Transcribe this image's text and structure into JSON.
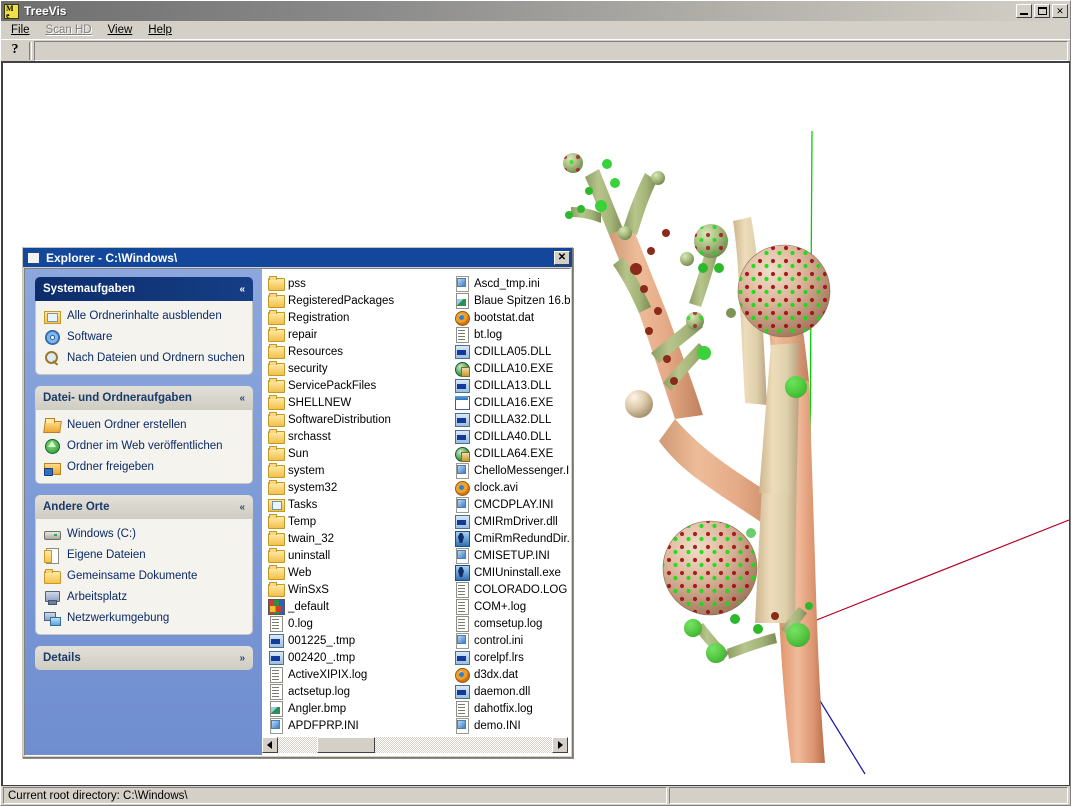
{
  "app": {
    "title": "TreeVis",
    "icon": "treevis-app-icon",
    "icon_glyph_top": "M",
    "icon_glyph_bottom": "e",
    "window_buttons": [
      {
        "name": "minimize-button",
        "label": "_"
      },
      {
        "name": "maximize-button",
        "label": "□"
      },
      {
        "name": "close-button",
        "label": "✕"
      }
    ],
    "menu": [
      {
        "label": "File",
        "enabled": true
      },
      {
        "label": "Scan HD",
        "enabled": false
      },
      {
        "label": "View",
        "enabled": true
      },
      {
        "label": "Help",
        "enabled": true
      }
    ],
    "toolbar": {
      "help_button_label": "?"
    },
    "statusbar": {
      "main": "Current root directory: C:\\Windows\\",
      "secondary": ""
    }
  },
  "explorer": {
    "title": "Explorer - C:\\Windows\\",
    "close_label": "✕",
    "panels": [
      {
        "name": "systemaufgaben",
        "title": "Systemaufgaben",
        "style": "blue",
        "chevron": "«",
        "collapsed": false,
        "items": [
          {
            "label": "Alle Ordnerinhalte ausblenden",
            "icon": "folder-window-icon"
          },
          {
            "label": "Software",
            "icon": "cd-software-icon"
          },
          {
            "label": "Nach Dateien und Ordnern suchen",
            "icon": "search-icon"
          }
        ]
      },
      {
        "name": "datei-und-ordneraufgaben",
        "title": "Datei- und Ordneraufgaben",
        "style": "gray",
        "chevron": "«",
        "collapsed": false,
        "items": [
          {
            "label": "Neuen Ordner erstellen",
            "icon": "new-folder-icon"
          },
          {
            "label": "Ordner im Web veröffentlichen",
            "icon": "web-publish-icon"
          },
          {
            "label": "Ordner freigeben",
            "icon": "share-folder-icon"
          }
        ]
      },
      {
        "name": "andere-orte",
        "title": "Andere Orte",
        "style": "gray",
        "chevron": "«",
        "collapsed": false,
        "items": [
          {
            "label": "Windows (C:)",
            "icon": "hard-drive-icon"
          },
          {
            "label": "Eigene Dateien",
            "icon": "my-documents-icon"
          },
          {
            "label": "Gemeinsame Dokumente",
            "icon": "shared-documents-icon"
          },
          {
            "label": "Arbeitsplatz",
            "icon": "my-computer-icon"
          },
          {
            "label": "Netzwerkumgebung",
            "icon": "network-icon"
          }
        ]
      },
      {
        "name": "details",
        "title": "Details",
        "style": "gray",
        "chevron": "»",
        "collapsed": true,
        "items": []
      }
    ],
    "file_columns": [
      {
        "name": "file-column-1",
        "items": [
          {
            "label": "pss",
            "icon": "folder-icon"
          },
          {
            "label": "RegisteredPackages",
            "icon": "folder-icon"
          },
          {
            "label": "Registration",
            "icon": "folder-icon"
          },
          {
            "label": "repair",
            "icon": "folder-icon"
          },
          {
            "label": "Resources",
            "icon": "folder-icon"
          },
          {
            "label": "security",
            "icon": "folder-icon"
          },
          {
            "label": "ServicePackFiles",
            "icon": "folder-icon"
          },
          {
            "label": "SHELLNEW",
            "icon": "folder-icon"
          },
          {
            "label": "SoftwareDistribution",
            "icon": "folder-icon"
          },
          {
            "label": "srchasst",
            "icon": "folder-icon"
          },
          {
            "label": "Sun",
            "icon": "folder-icon"
          },
          {
            "label": "system",
            "icon": "folder-icon"
          },
          {
            "label": "system32",
            "icon": "folder-icon"
          },
          {
            "label": "Tasks",
            "icon": "folder-task-icon"
          },
          {
            "label": "Temp",
            "icon": "folder-icon"
          },
          {
            "label": "twain_32",
            "icon": "folder-icon"
          },
          {
            "label": "uninstall",
            "icon": "folder-icon"
          },
          {
            "label": "Web",
            "icon": "folder-icon"
          },
          {
            "label": "WinSxS",
            "icon": "folder-icon"
          },
          {
            "label": "_default",
            "icon": "mixed-media-icon"
          },
          {
            "label": "0.log",
            "icon": "log-file-icon"
          },
          {
            "label": "001225_.tmp",
            "icon": "dll-file-icon"
          },
          {
            "label": "002420_.tmp",
            "icon": "dll-file-icon"
          },
          {
            "label": "ActiveXIPIX.log",
            "icon": "log-file-icon"
          },
          {
            "label": "actsetup.log",
            "icon": "log-file-icon"
          },
          {
            "label": "Angler.bmp",
            "icon": "bitmap-file-icon"
          },
          {
            "label": "APDFPRP.INI",
            "icon": "ini-file-icon"
          }
        ]
      },
      {
        "name": "file-column-2",
        "items": [
          {
            "label": "Ascd_tmp.ini",
            "icon": "ini-file-icon"
          },
          {
            "label": "Blaue Spitzen 16.b",
            "icon": "bitmap-file-icon"
          },
          {
            "label": "bootstat.dat",
            "icon": "dat-file-icon"
          },
          {
            "label": "bt.log",
            "icon": "log-file-icon"
          },
          {
            "label": "CDILLA05.DLL",
            "icon": "dll-file-icon"
          },
          {
            "label": "CDILLA10.EXE",
            "icon": "exe-file-icon"
          },
          {
            "label": "CDILLA13.DLL",
            "icon": "dll-file-icon"
          },
          {
            "label": "CDILLA16.EXE",
            "icon": "window-exe-icon"
          },
          {
            "label": "CDILLA32.DLL",
            "icon": "dll-file-icon"
          },
          {
            "label": "CDILLA40.DLL",
            "icon": "dll-file-icon"
          },
          {
            "label": "CDILLA64.EXE",
            "icon": "exe-file-icon"
          },
          {
            "label": "ChelloMessenger.I",
            "icon": "ini-file-icon"
          },
          {
            "label": "clock.avi",
            "icon": "avi-file-icon"
          },
          {
            "label": "CMCDPLAY.INI",
            "icon": "ini-file-icon"
          },
          {
            "label": "CMIRmDriver.dll",
            "icon": "dll-file-icon"
          },
          {
            "label": "CmiRmRedundDir.e",
            "icon": "runnable-exe-icon"
          },
          {
            "label": "CMISETUP.INI",
            "icon": "ini-file-icon"
          },
          {
            "label": "CMIUninstall.exe",
            "icon": "runnable-exe-icon"
          },
          {
            "label": "COLORADO.LOG",
            "icon": "log-file-icon"
          },
          {
            "label": "COM+.log",
            "icon": "log-file-icon"
          },
          {
            "label": "comsetup.log",
            "icon": "log-file-icon"
          },
          {
            "label": "control.ini",
            "icon": "ini-file-icon"
          },
          {
            "label": "corelpf.lrs",
            "icon": "lrs-file-icon"
          },
          {
            "label": "d3dx.dat",
            "icon": "dat-file-icon"
          },
          {
            "label": "daemon.dll",
            "icon": "dll-file-icon"
          },
          {
            "label": "dahotfix.log",
            "icon": "log-file-icon"
          },
          {
            "label": "demo.INI",
            "icon": "ini-file-icon"
          }
        ]
      }
    ],
    "scrollbar": {
      "left_arrow": "◀",
      "right_arrow": "▶",
      "thumb_position_percent": 18
    }
  },
  "visualization": {
    "name": "treevis-3d-view",
    "background": "#ffffff",
    "axes": [
      {
        "name": "y-axis",
        "color": "#00d000"
      },
      {
        "name": "x-axis",
        "color": "#c00030"
      },
      {
        "name": "z-axis",
        "color": "#1010a0"
      }
    ],
    "colors": {
      "trunk": "#e8a882",
      "trunk_shadow": "#c07a56",
      "branch_light": "#e8cba8",
      "branch_green": "#a8b878",
      "sphere_base": "#d8b098",
      "sphere_green": "#00e000",
      "sphere_red": "#a01010"
    }
  }
}
